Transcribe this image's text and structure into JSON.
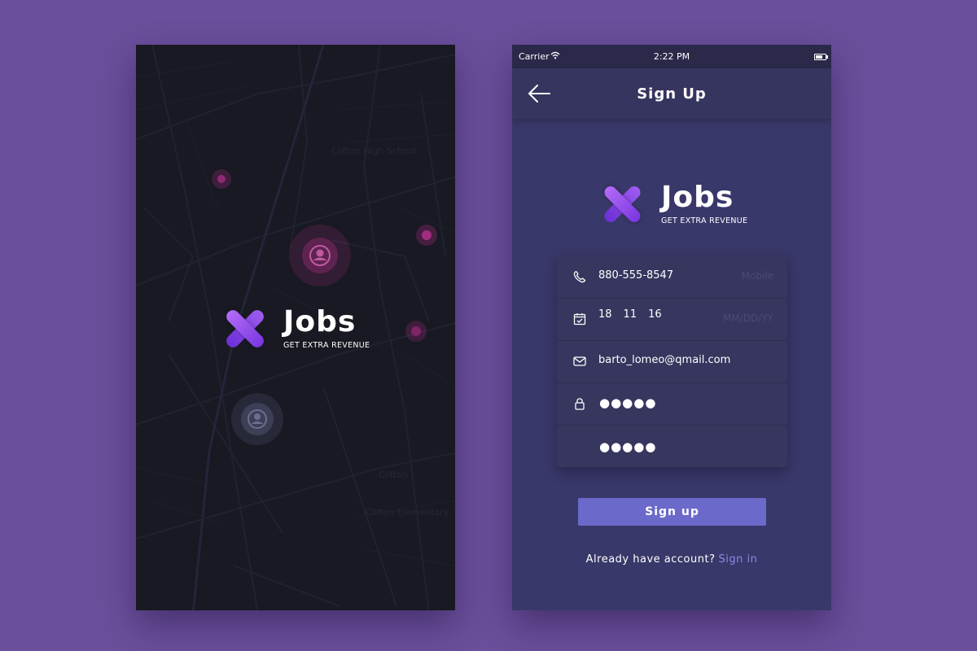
{
  "brand": {
    "name": "Jobs",
    "tagline": "GET EXTRA REVENUE",
    "gradient_start": "#9f5cf2",
    "gradient_end": "#6b2fd6",
    "logo_icon": "x-cross-icon"
  },
  "map": {
    "labels": [
      "Clifton High School",
      "Clifton",
      "Clifton Elementary"
    ],
    "pin_colors": {
      "pink": "#b0308a",
      "gray": "#3b3d55"
    }
  },
  "status_bar": {
    "carrier": "Carrier",
    "wifi_icon": "wifi-icon",
    "time": "2:22 PM",
    "battery_icon": "battery-icon"
  },
  "nav": {
    "title": "Sign Up",
    "back_icon": "arrow-left-icon"
  },
  "form": {
    "mobile": {
      "value": "880-555-8547",
      "placeholder": "Mobile",
      "icon": "phone-icon"
    },
    "date": {
      "month": "18",
      "day": "11",
      "year": "16",
      "placeholder": "MM/DD/YY",
      "icon": "calendar-check-icon"
    },
    "email": {
      "value": "barto_lomeo@qmail.com",
      "icon": "envelope-icon"
    },
    "password": {
      "value": "●●●●●",
      "icon": "lock-icon"
    },
    "confirm_password": {
      "value": "●●●●●"
    }
  },
  "actions": {
    "signup_label": "Sign up",
    "already_text": "Already have account?",
    "signin_label": "Sign in"
  },
  "colors": {
    "page_background": "#6a4f9c",
    "card_background": "#39386a",
    "button": "#6b69c9",
    "link": "#8c8ae6"
  }
}
